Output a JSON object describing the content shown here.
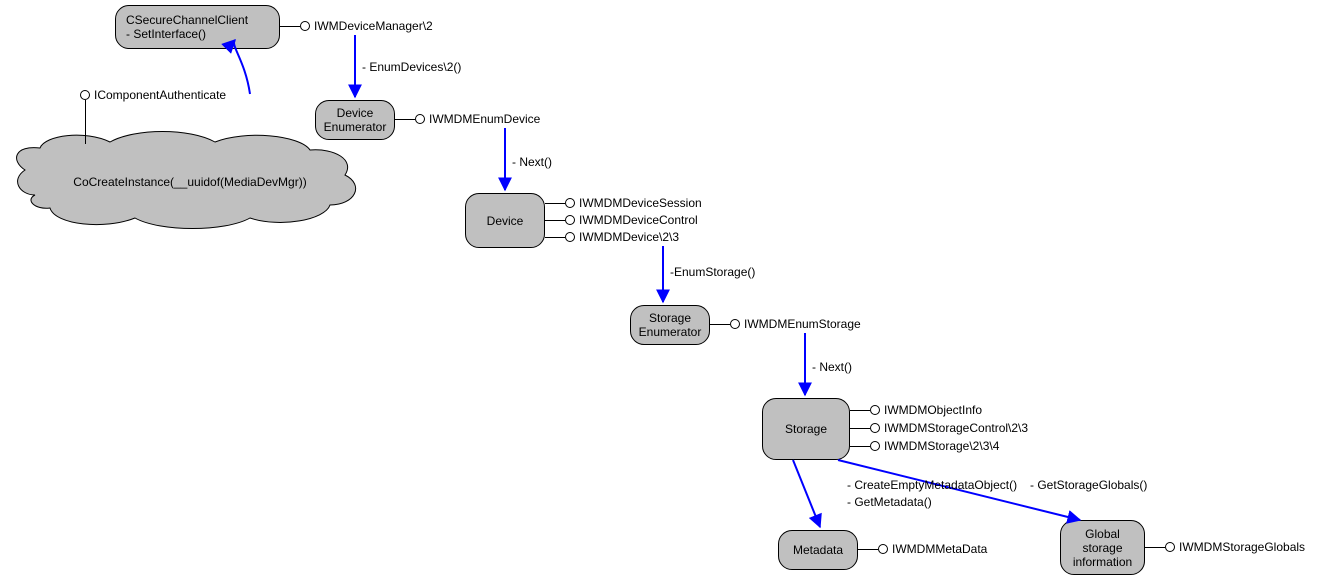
{
  "nodes": {
    "secureChannel": {
      "line1": "CSecureChannelClient",
      "line2": "- SetInterface()"
    },
    "cloud": "CoCreateInstance(__uuidof(MediaDevMgr))",
    "deviceEnum": {
      "line1": "Device",
      "line2": "Enumerator"
    },
    "device": "Device",
    "storageEnum": {
      "line1": "Storage",
      "line2": "Enumerator"
    },
    "storage": "Storage",
    "metadata": "Metadata",
    "globalStorage": {
      "line1": "Global",
      "line2": "storage",
      "line3": "information"
    }
  },
  "interfaces": {
    "devMgr": "IWMDeviceManager\\2",
    "compAuth": "IComponentAuthenticate",
    "enumDevice": "IWMDMEnumDevice",
    "deviceSession": "IWMDMDeviceSession",
    "deviceControl": "IWMDMDeviceControl",
    "device23": "IWMDMDevice\\2\\3",
    "enumStorage": "IWMDMEnumStorage",
    "objectInfo": "IWMDMObjectInfo",
    "storageControl": "IWMDMStorageControl\\2\\3",
    "storage234": "IWMDMStorage\\2\\3\\4",
    "metaData": "IWMDMMetaData",
    "storageGlobals": "IWMDMStorageGlobals"
  },
  "edges": {
    "enumDevices": "- EnumDevices\\2()",
    "next1": "- Next()",
    "enumStorage": "-EnumStorage()",
    "next2": "- Next()",
    "createMeta": "- CreateEmptyMetadataObject()",
    "getMeta": "- GetMetadata()",
    "getGlobals": "- GetStorageGlobals()"
  }
}
